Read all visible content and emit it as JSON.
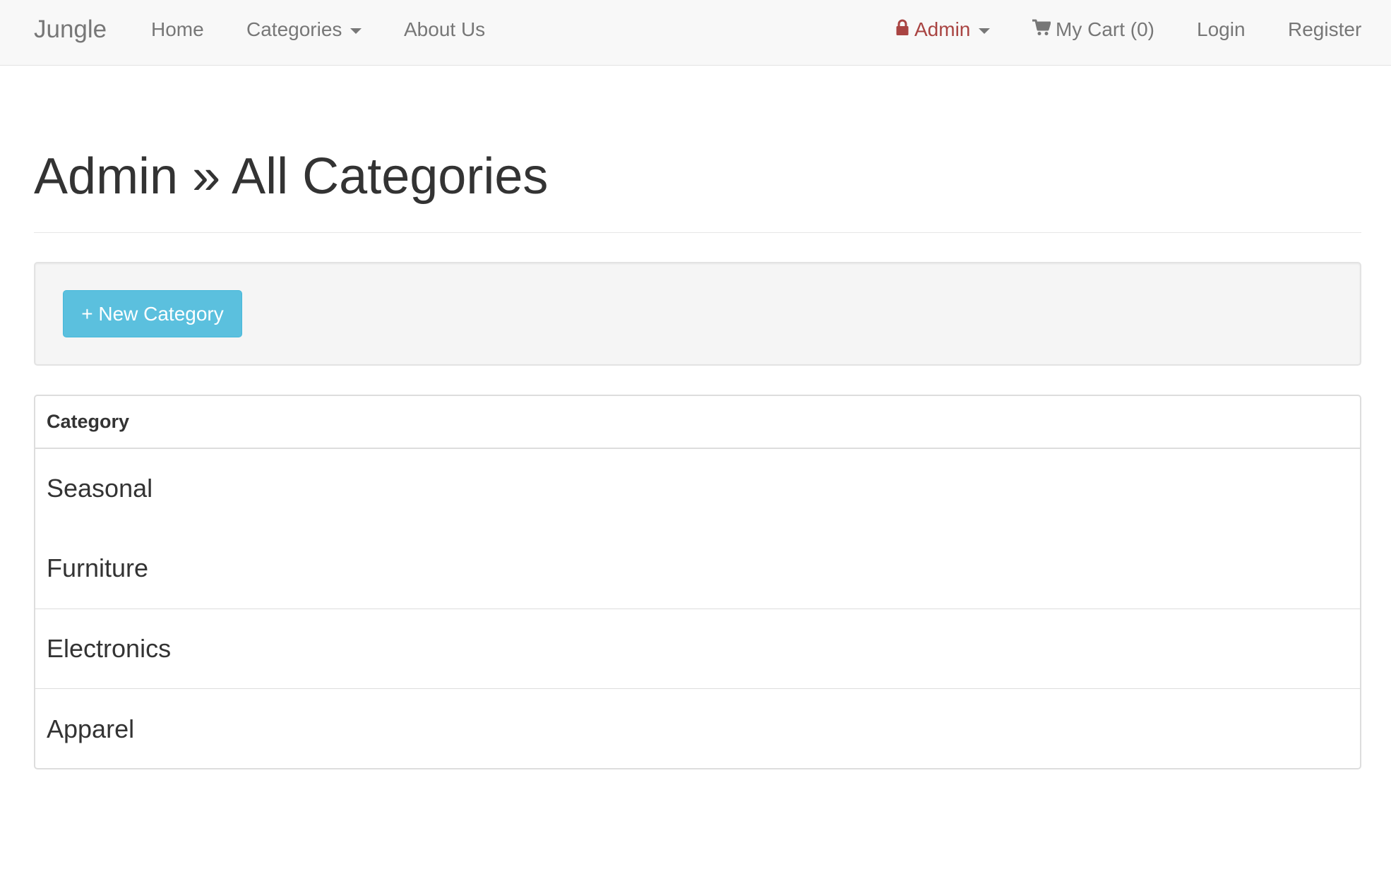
{
  "navbar": {
    "brand": "Jungle",
    "left_links": {
      "home": "Home",
      "categories": "Categories",
      "about": "About Us"
    },
    "right_links": {
      "admin": "Admin",
      "cart": "My Cart (0)",
      "login": "Login",
      "register": "Register"
    }
  },
  "page": {
    "title": "Admin » All Categories",
    "new_button": "+ New Category"
  },
  "table": {
    "header": "Category",
    "rows": [
      "Seasonal",
      "Furniture",
      "Electronics",
      "Apparel"
    ]
  },
  "colors": {
    "navbar_bg": "#f8f8f8",
    "admin_text": "#a94442",
    "button_info": "#5bc0de",
    "well_bg": "#f5f5f5"
  },
  "icons": {
    "admin": "lock-icon",
    "cart": "shopping-cart-icon",
    "dropdown": "caret-down-icon"
  }
}
